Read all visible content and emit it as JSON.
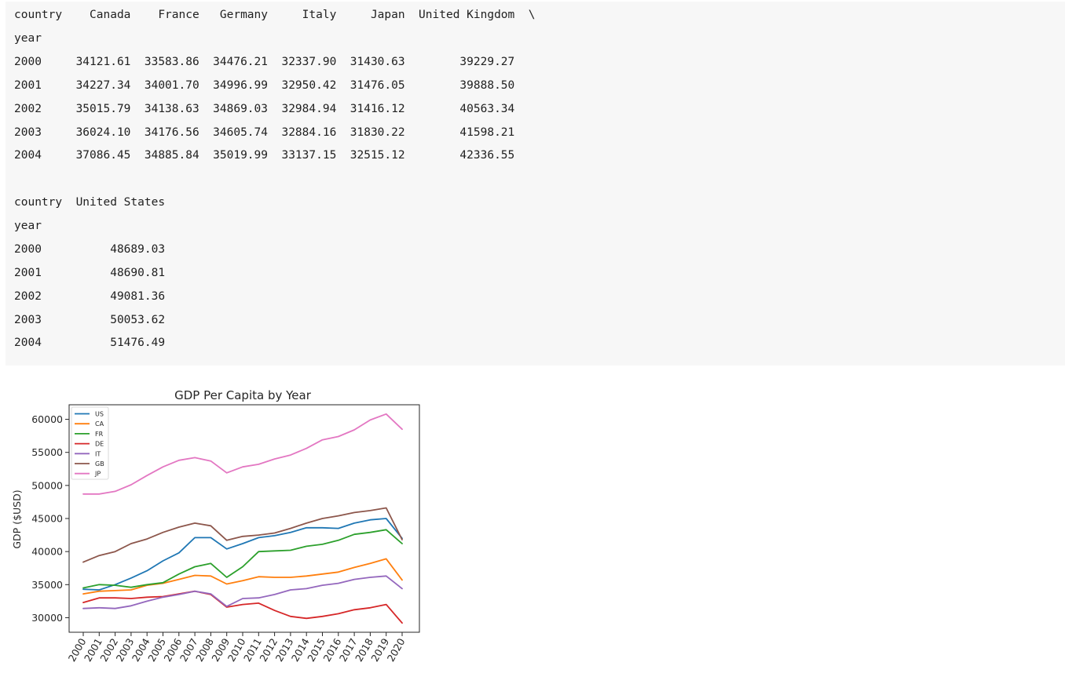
{
  "output": {
    "lines": [
      "country    Canada    France   Germany     Italy     Japan  United Kingdom  \\",
      "year",
      "2000     34121.61  33583.86  34476.21  32337.90  31430.63        39229.27",
      "2001     34227.34  34001.70  34996.99  32950.42  31476.05        39888.50",
      "2002     35015.79  34138.63  34869.03  32984.94  31416.12        40563.34",
      "2003     36024.10  34176.56  34605.74  32884.16  31830.22        41598.21",
      "2004     37086.45  34885.84  35019.99  33137.15  32515.12        42336.55",
      "",
      "country  United States",
      "year",
      "2000          48689.03",
      "2001          48690.81",
      "2002          49081.36",
      "2003          50053.62",
      "2004          51476.49"
    ]
  },
  "chart_data": {
    "type": "line",
    "title": "GDP Per Capita by Year",
    "xlabel": "",
    "ylabel": "GDP ($USD)",
    "x": [
      "2000",
      "2001",
      "2002",
      "2003",
      "2004",
      "2005",
      "2006",
      "2007",
      "2008",
      "2009",
      "2010",
      "2011",
      "2012",
      "2013",
      "2014",
      "2015",
      "2016",
      "2017",
      "2018",
      "2019",
      "2020"
    ],
    "ylim": [
      27800,
      62200
    ],
    "yticks": [
      30000,
      35000,
      40000,
      45000,
      50000,
      55000,
      60000
    ],
    "legend_position": "top-left",
    "grid": false,
    "series": [
      {
        "name": "US",
        "color": "#1f77b4",
        "values": [
          34300,
          34200,
          35000,
          36000,
          37100,
          38600,
          39800,
          42100,
          42100,
          40400,
          41200,
          42100,
          42400,
          42900,
          43600,
          43600,
          43500,
          44300,
          44800,
          45000,
          42000
        ]
      },
      {
        "name": "CA",
        "color": "#ff7f0e",
        "values": [
          33600,
          34000,
          34100,
          34200,
          34900,
          35200,
          35800,
          36400,
          36300,
          35100,
          35600,
          36200,
          36100,
          36100,
          36300,
          36600,
          36900,
          37600,
          38200,
          38900,
          35700
        ]
      },
      {
        "name": "FR",
        "color": "#2ca02c",
        "values": [
          34500,
          35000,
          34900,
          34600,
          35000,
          35300,
          36600,
          37700,
          38200,
          36100,
          37700,
          40000,
          40100,
          40200,
          40800,
          41100,
          41700,
          42600,
          42900,
          43300,
          41200
        ]
      },
      {
        "name": "DE",
        "color": "#d62728",
        "values": [
          32300,
          33000,
          33000,
          32900,
          33100,
          33200,
          33600,
          34000,
          33500,
          31600,
          32000,
          32200,
          31100,
          30200,
          29900,
          30200,
          30600,
          31200,
          31500,
          32000,
          29200
        ]
      },
      {
        "name": "IT",
        "color": "#9467bd",
        "values": [
          31400,
          31500,
          31400,
          31800,
          32500,
          33100,
          33500,
          34000,
          33600,
          31700,
          32900,
          33000,
          33500,
          34200,
          34400,
          34900,
          35200,
          35800,
          36100,
          36300,
          34400
        ]
      },
      {
        "name": "GB",
        "color": "#8c564b",
        "values": [
          38400,
          39400,
          40000,
          41200,
          41900,
          42900,
          43700,
          44300,
          43900,
          41700,
          42300,
          42500,
          42800,
          43500,
          44300,
          45000,
          45400,
          45900,
          46200,
          46600,
          41800
        ]
      },
      {
        "name": "JP",
        "color": "#e377c2",
        "values": [
          48700,
          48700,
          49100,
          50100,
          51500,
          52800,
          53800,
          54200,
          53700,
          51900,
          52800,
          53200,
          54000,
          54600,
          55600,
          56900,
          57400,
          58400,
          59900,
          60800,
          58500
        ]
      }
    ]
  }
}
